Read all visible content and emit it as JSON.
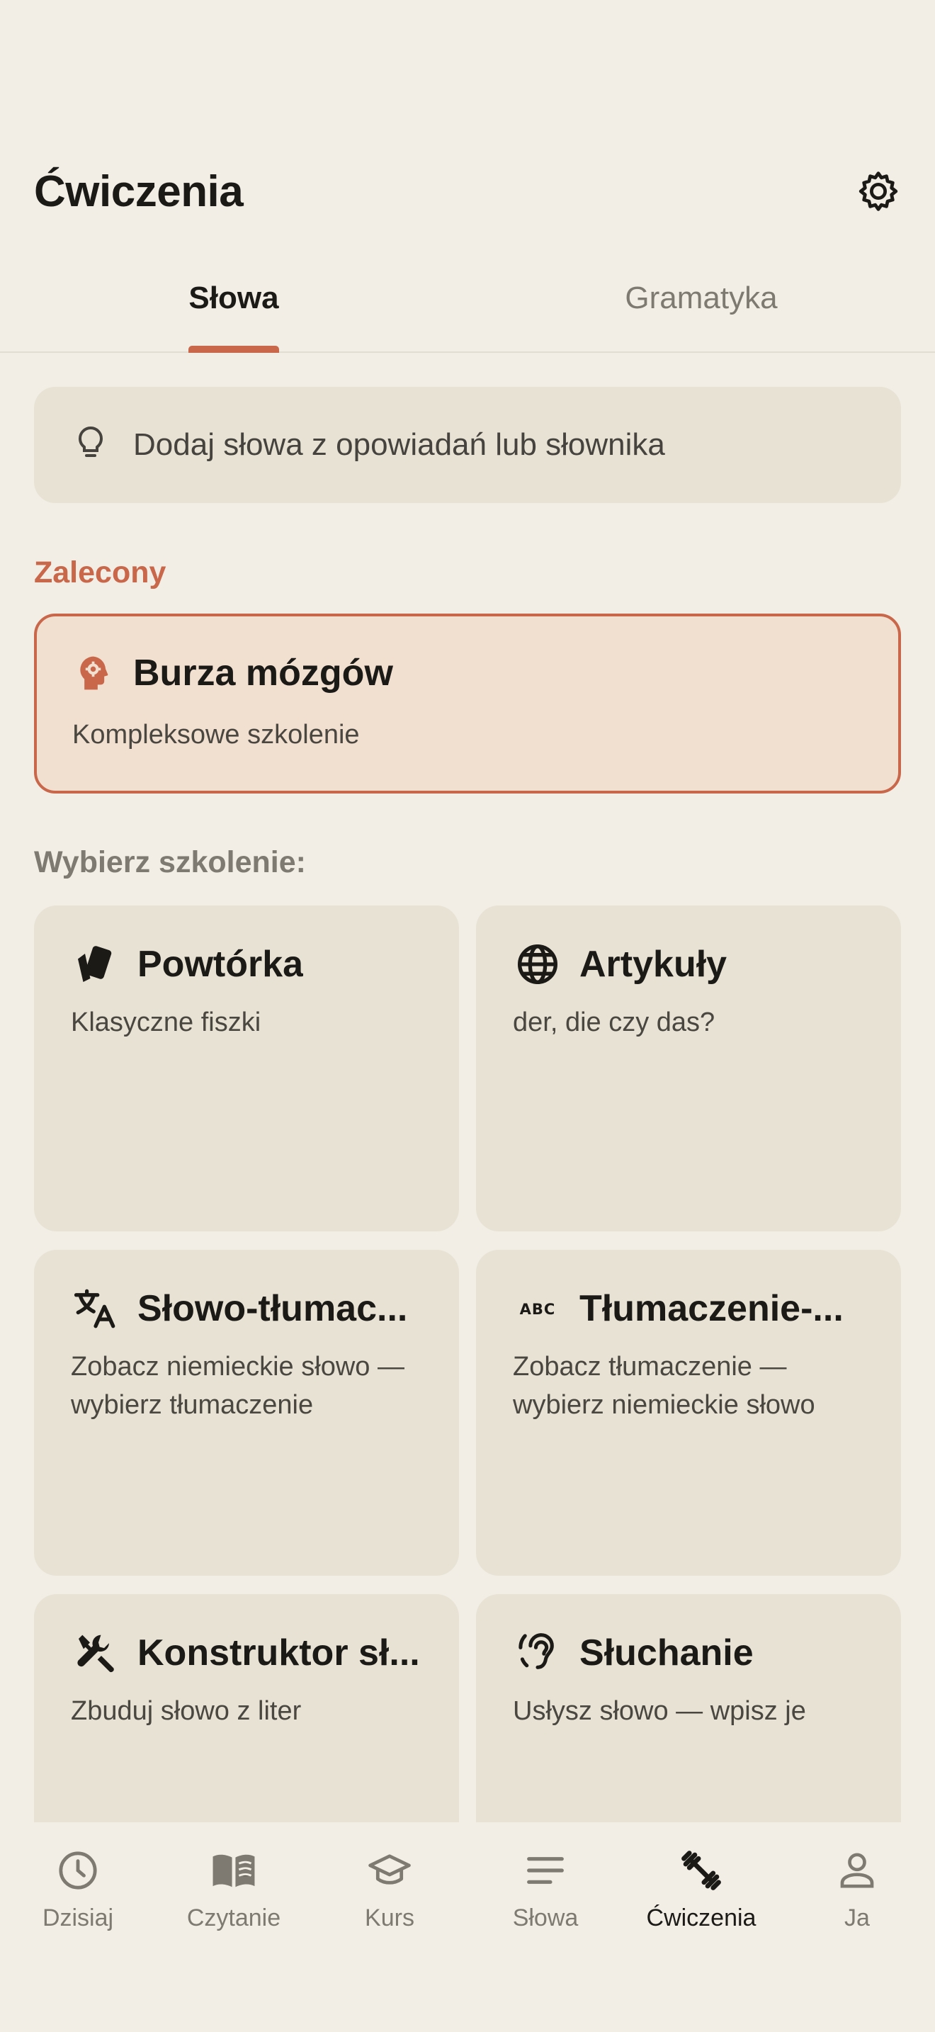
{
  "header": {
    "title": "Ćwiczenia"
  },
  "tabs": [
    {
      "label": "Słowa",
      "active": true
    },
    {
      "label": "Gramatyka",
      "active": false
    }
  ],
  "hint": {
    "text": "Dodaj słowa z opowiadań lub słownika",
    "icon": "lightbulb-icon"
  },
  "recommended": {
    "section_label": "Zalecony",
    "title": "Burza mózgów",
    "subtitle": "Kompleksowe szkolenie",
    "icon": "brain-gear-icon"
  },
  "choose_label": "Wybierz szkolenie:",
  "trainings": [
    {
      "title": "Powtórka",
      "subtitle": "Klasyczne fiszki",
      "icon": "cards-icon"
    },
    {
      "title": "Artykuły",
      "subtitle": "der, die czy das?",
      "icon": "globe-icon"
    },
    {
      "title": "Słowo-tłumac...",
      "subtitle": "Zobacz niemieckie słowo — wybierz tłumaczenie",
      "icon": "translate-icon"
    },
    {
      "title": "Tłumaczenie-...",
      "subtitle": "Zobacz tłumaczenie — wybierz niemieckie słowo",
      "icon": "abc-icon"
    },
    {
      "title": "Konstruktor sł...",
      "subtitle": "Zbuduj słowo z liter",
      "icon": "tools-icon"
    },
    {
      "title": "Słuchanie",
      "subtitle": "Usłysz słowo — wpisz je",
      "icon": "ear-icon"
    }
  ],
  "nav": [
    {
      "label": "Dzisiaj",
      "icon": "clock-icon",
      "active": false
    },
    {
      "label": "Czytanie",
      "icon": "book-icon",
      "active": false
    },
    {
      "label": "Kurs",
      "icon": "graduation-cap-icon",
      "active": false
    },
    {
      "label": "Słowa",
      "icon": "lines-icon",
      "active": false
    },
    {
      "label": "Ćwiczenia",
      "icon": "dumbbell-icon",
      "active": true
    },
    {
      "label": "Ja",
      "icon": "person-icon",
      "active": false
    }
  ],
  "colors": {
    "accent": "#C8674A",
    "background": "#F2EEE5",
    "card": "#E7E2D4",
    "recommended_bg": "#F1DFD0"
  }
}
